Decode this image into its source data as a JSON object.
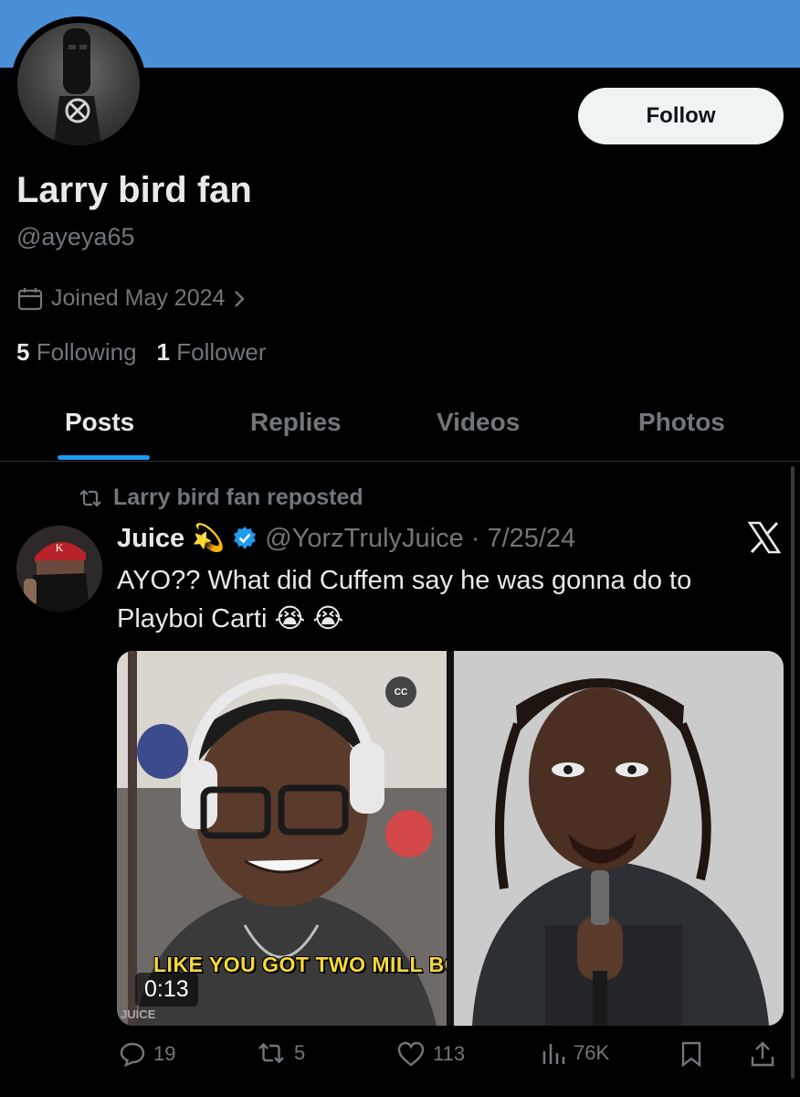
{
  "profile": {
    "name": "Larry bird fan",
    "handle": "@ayeya65",
    "joined": "Joined May 2024",
    "following_count": "5",
    "following_label": "Following",
    "followers_count": "1",
    "followers_label": "Follower",
    "follow_label": "Follow"
  },
  "tabs": [
    {
      "label": "Posts",
      "active": true
    },
    {
      "label": "Replies",
      "active": false
    },
    {
      "label": "Videos",
      "active": false
    },
    {
      "label": "Photos",
      "active": false
    }
  ],
  "post": {
    "repost_text": "Larry bird fan reposted",
    "author_name": "Juice",
    "author_emoji": "💫",
    "author_handle": "@YorzTrulyJuice",
    "date": "7/25/24",
    "text": "AYO?? What did Cuffem say he was gonna do to Playboi Carti",
    "text_emojis": "😭 😭",
    "video_subtitle": "LIKE YOU GOT TWO MILL BC",
    "video_duration": "0:13",
    "video_watermark": "JUICE",
    "cc_label": "CC",
    "stats": {
      "replies": "19",
      "reposts": "5",
      "likes": "113",
      "views": "76K"
    }
  },
  "colors": {
    "banner": "#4a90d9",
    "accent": "#1d9bf0",
    "verified": "#1d9bf0",
    "muted": "#71767b"
  },
  "icons": [
    "calendar-icon",
    "chevron-right-icon",
    "repost-icon",
    "verified-badge-icon",
    "x-logo-icon",
    "reply-icon",
    "like-icon",
    "views-icon",
    "bookmark-icon",
    "share-icon"
  ]
}
